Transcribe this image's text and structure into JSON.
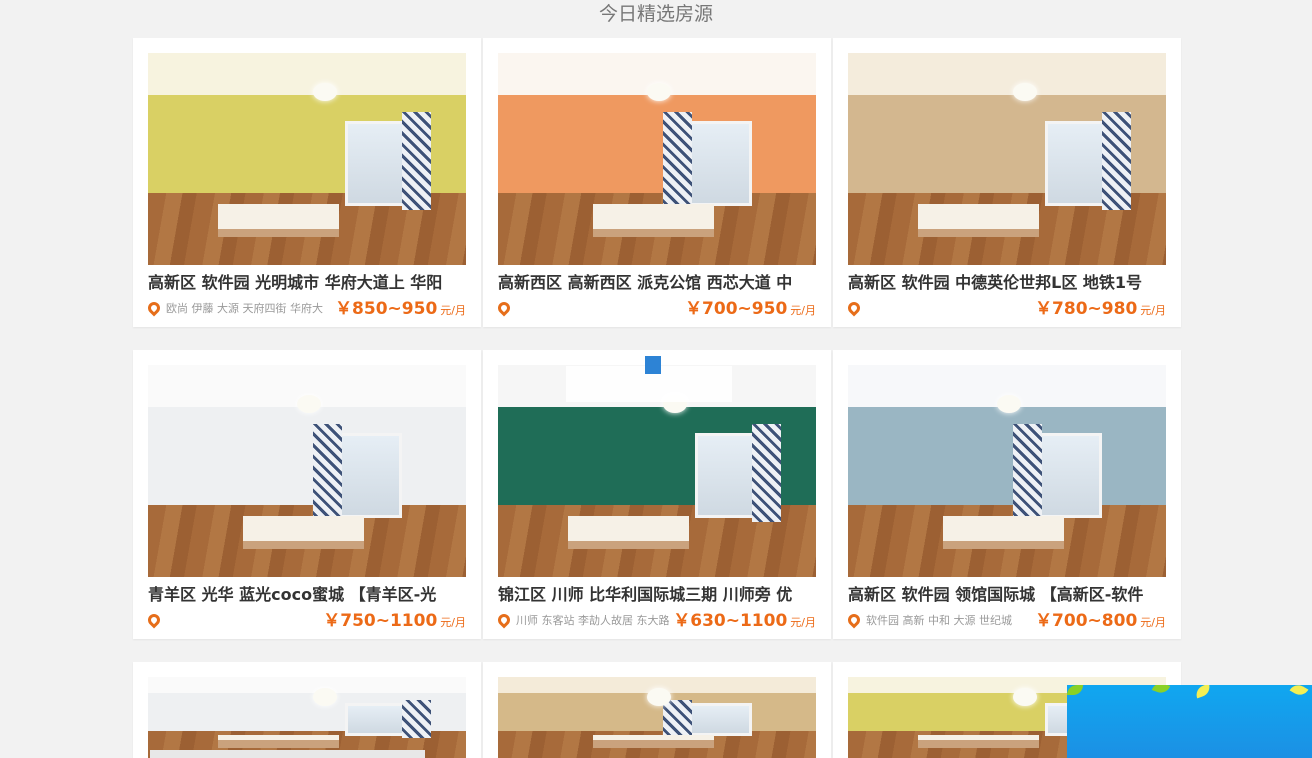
{
  "section": {
    "title": "今日精选房源"
  },
  "listings": [
    {
      "title": "高新区 软件园 光明城市 华府大道上 华阳",
      "location": "欧尚 伊藤 大源 天府四街 华府大",
      "price": "￥850~950",
      "unit": "元/月",
      "theme": "yellow"
    },
    {
      "title": "高新西区 高新西区 派克公馆 西芯大道 中",
      "location": "",
      "price": "￥700~950",
      "unit": "元/月",
      "theme": "orange"
    },
    {
      "title": "高新区 软件园 中德英伦世邦L区 地铁1号",
      "location": "",
      "price": "￥780~980",
      "unit": "元/月",
      "theme": "beige"
    },
    {
      "title": "青羊区 光华 蓝光coco蜜城 【青羊区-光",
      "location": "",
      "price": "￥750~1100",
      "unit": "元/月",
      "theme": "white"
    },
    {
      "title": "锦江区 川师 比华利国际城三期 川师旁 优",
      "location": "川师 东客站 李劼人故居 东大路",
      "price": "￥630~1100",
      "unit": "元/月",
      "theme": "green"
    },
    {
      "title": "高新区 软件园 领馆国际城 【高新区-软件",
      "location": "软件园 高新 中和 大源 世纪城",
      "price": "￥700~800",
      "unit": "元/月",
      "theme": "blue"
    }
  ],
  "row3": [
    {
      "theme": "white"
    },
    {
      "theme": "tan"
    },
    {
      "theme": "yellow"
    }
  ],
  "colors": {
    "accent": "#ec6a17",
    "background": "#f2f2f2"
  },
  "icons": {
    "location": "location-pin-icon"
  }
}
